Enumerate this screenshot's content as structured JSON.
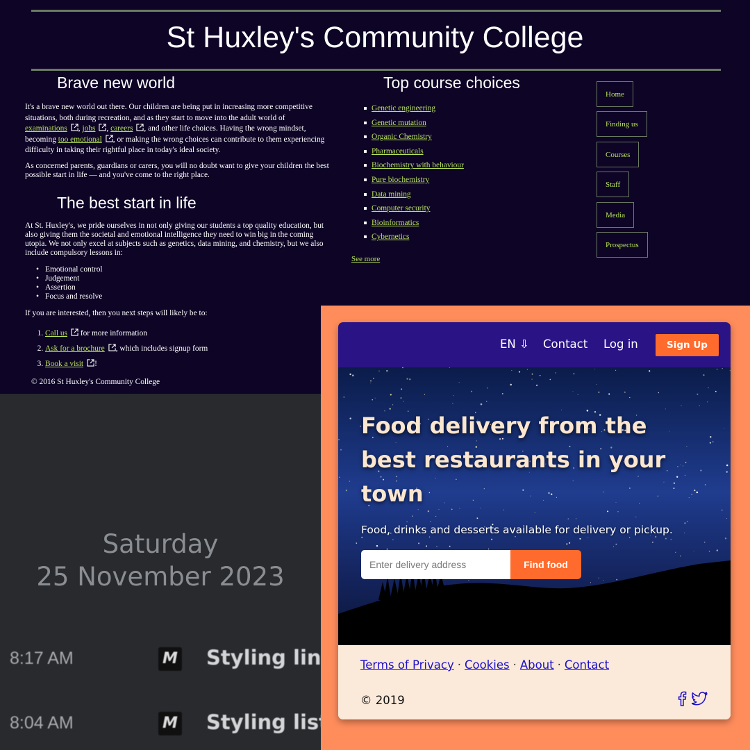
{
  "college": {
    "title": "St Huxley's Community College",
    "brave": {
      "heading": "Brave new world",
      "p1_start": "It's a brave new world out there. Our children are being put in increasing more competitive situations, both during recreation, and as they start to move into the adult world of",
      "links": [
        "examinations",
        "jobs",
        "careers"
      ],
      "p1_mid": ", and other life choices. Having the wrong mindset, becoming",
      "link_emotional": "too emotional",
      "p1_end": ", or making the wrong choices can contribute to them experiencing difficulty in taking their rightful place in today's ideal society.",
      "p2": "As concerned parents, guardians or carers, you will no doubt want to give your children the best possible start in life — and you've come to the right place."
    },
    "best": {
      "heading": "The best start in life",
      "p": "At St. Huxley's, we pride ourselves in not only giving our students a top quality education, but also giving them the societal and emotional intelligence they need to win big in the coming utopia. We not only excel at subjects such as genetics, data mining, and chemistry, but we also include compulsory lessons in:",
      "lessons": [
        "Emotional control",
        "Judgement",
        "Assertion",
        "Focus and resolve"
      ],
      "next": "If you are interested, then you next steps will likely be to:",
      "steps": [
        {
          "link": "Call us",
          "text": " for more information"
        },
        {
          "link": "Ask for a brochure",
          "text": ", which includes signup form"
        },
        {
          "link": "Book a visit",
          "text": "!"
        }
      ],
      "footer": "© 2016 St Huxley's Community College"
    },
    "courses": {
      "heading": "Top course choices",
      "items": [
        "Genetic engineering",
        "Genetic mutation",
        "Organic Chemistry",
        "Pharmaceuticals",
        "Biochemistry with behaviour",
        "Pure biochemistry",
        "Data mining",
        "Computer security",
        "Bioinformatics",
        "Cybernetics"
      ],
      "see_more": "See more"
    },
    "nav": [
      "Home",
      "Finding us",
      "Courses",
      "Staff",
      "Media",
      "Prospectus"
    ],
    "colors": {
      "background": "#0e0426",
      "link": "#b7e35a",
      "rule": "#6b7a62"
    }
  },
  "clock": {
    "day": "Saturday",
    "date": "25 November 2023",
    "history": [
      {
        "time": "8:17 AM",
        "icon": "M",
        "title": "Styling links"
      },
      {
        "time": "8:04 AM",
        "icon": "M",
        "title": "Styling lists -"
      }
    ]
  },
  "food": {
    "nav": {
      "lang": "EN ⇩",
      "contact": "Contact",
      "login": "Log in",
      "signup": "Sign Up"
    },
    "headline": "Food delivery from the best restaurants in your town",
    "subtitle": "Food, drinks and desserts available for delivery or pickup.",
    "search_placeholder": "Enter delivery address",
    "find_button": "Find food",
    "footer_links": [
      "Terms of Privacy",
      "Cookies",
      "About",
      "Contact"
    ],
    "separator": "·",
    "copyright": "© 2019",
    "social_icons": [
      "facebook-icon",
      "twitter-icon"
    ],
    "colors": {
      "page_bg": "#ff8d5c",
      "nav_bg": "#2a1385",
      "accent": "#ff6b2c",
      "footer_bg": "#fbeada",
      "link": "#1c0fc9"
    }
  }
}
